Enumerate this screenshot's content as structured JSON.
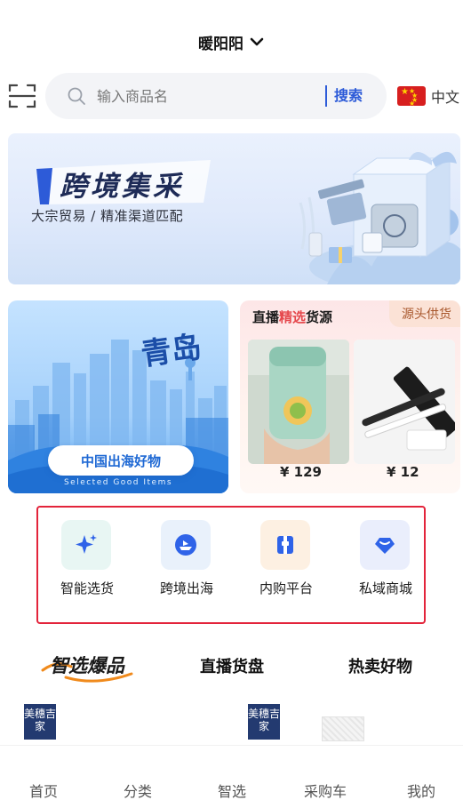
{
  "header": {
    "shop_name": "暖阳阳"
  },
  "search": {
    "placeholder": "输入商品名",
    "button_label": "搜索"
  },
  "language": {
    "label": "中文"
  },
  "banner": {
    "title": "跨境集采",
    "subtitle": "大宗贸易 / 精准渠道匹配"
  },
  "qingdao_card": {
    "script_text": "青岛",
    "cta_label": "中国出海好物",
    "cta_sub": "Selected Good Items"
  },
  "live_card": {
    "title_prefix": "直播",
    "title_highlight": "精选",
    "title_suffix": "货源",
    "tag": "源头供货",
    "products": [
      {
        "price": "¥ 129"
      },
      {
        "price": "¥ 12"
      }
    ]
  },
  "tools": [
    {
      "label": "智能选货",
      "icon": "sparkle-icon",
      "bg": "#e8f6f3",
      "fg": "#2f63e8"
    },
    {
      "label": "跨境出海",
      "icon": "ship-icon",
      "bg": "#e9f1fb",
      "fg": "#2f63e8"
    },
    {
      "label": "内购平台",
      "icon": "gift-box-icon",
      "bg": "#fdf0e2",
      "fg": "#2f63e8"
    },
    {
      "label": "私域商城",
      "icon": "diamond-heart-icon",
      "bg": "#eaeefc",
      "fg": "#2f63e8"
    }
  ],
  "section_tabs": {
    "logo_text": "智选爆品",
    "tab2": "直播货盘",
    "tab3": "热卖好物"
  },
  "peek_items": {
    "brand_text": "美穗吉家"
  },
  "bottom_nav": {
    "items": [
      "首页",
      "分类",
      "智选",
      "采购车",
      "我的"
    ]
  },
  "colors": {
    "accent": "#2d5bd8",
    "highlight": "#e5484d",
    "outline": "#e3243b"
  }
}
